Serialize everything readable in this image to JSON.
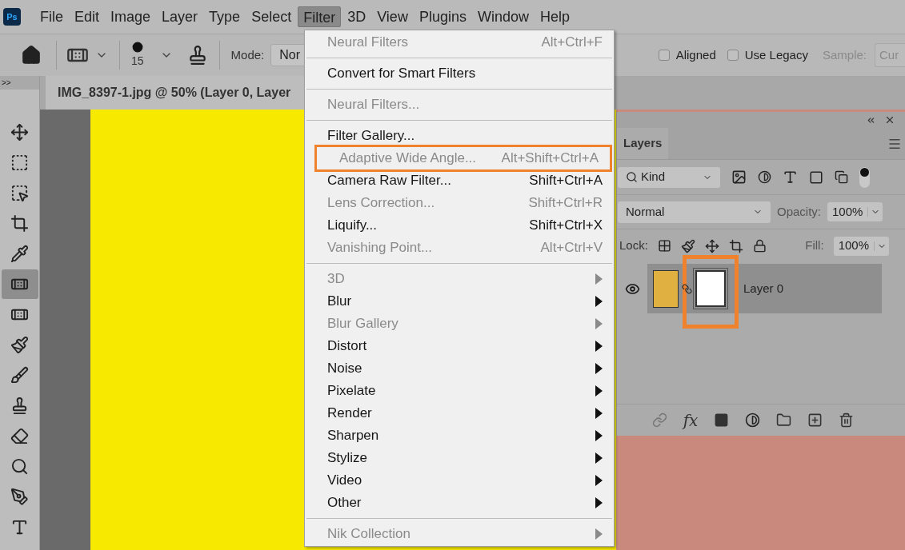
{
  "app_logo": "Ps",
  "menubar": [
    {
      "label": "File",
      "selected": false
    },
    {
      "label": "Edit",
      "selected": false
    },
    {
      "label": "Image",
      "selected": false
    },
    {
      "label": "Layer",
      "selected": false
    },
    {
      "label": "Type",
      "selected": false
    },
    {
      "label": "Select",
      "selected": false
    },
    {
      "label": "Filter",
      "selected": true
    },
    {
      "label": "3D",
      "selected": false
    },
    {
      "label": "View",
      "selected": false
    },
    {
      "label": "Plugins",
      "selected": false
    },
    {
      "label": "Window",
      "selected": false
    },
    {
      "label": "Help",
      "selected": false
    }
  ],
  "options_bar": {
    "brush_size": "15",
    "mode_label": "Mode:",
    "mode_value": "Nor",
    "checkboxes": [
      {
        "label": "Aligned",
        "checked": false
      },
      {
        "label": "Use Legacy",
        "checked": false
      }
    ],
    "sample_label": "Sample:",
    "sample_value": "Cur"
  },
  "toolbar": {
    "collapse": ">>",
    "tools": [
      {
        "kind": "move",
        "selected": false
      },
      {
        "kind": "marquee",
        "selected": false
      },
      {
        "kind": "object-select",
        "selected": false
      },
      {
        "kind": "crop",
        "selected": false
      },
      {
        "kind": "eyedropper",
        "selected": false
      },
      {
        "kind": "healing",
        "selected": true
      },
      {
        "kind": "spot-healing",
        "selected": false
      },
      {
        "kind": "brush",
        "selected": false
      },
      {
        "kind": "mixer-brush",
        "selected": false
      },
      {
        "kind": "stamp",
        "selected": false
      },
      {
        "kind": "eraser",
        "selected": false
      },
      {
        "kind": "burn",
        "selected": false
      },
      {
        "kind": "pen",
        "selected": false
      },
      {
        "kind": "type",
        "selected": false
      }
    ]
  },
  "document_tab": {
    "title": "IMG_8397-1.jpg @ 50% (Layer 0, Layer"
  },
  "filter_menu": [
    {
      "kind": "item",
      "label": "Neural Filters",
      "shortcut": "Alt+Ctrl+F",
      "disabled": true,
      "annotated": false
    },
    {
      "kind": "separator"
    },
    {
      "kind": "item",
      "label": "Convert for Smart Filters",
      "disabled": false,
      "annotated": false
    },
    {
      "kind": "separator"
    },
    {
      "kind": "item",
      "label": "Neural Filters...",
      "disabled": true,
      "annotated": false
    },
    {
      "kind": "separator"
    },
    {
      "kind": "item",
      "label": "Filter Gallery...",
      "disabled": false,
      "annotated": false
    },
    {
      "kind": "item",
      "label": "Adaptive Wide Angle...",
      "shortcut": "Alt+Shift+Ctrl+A",
      "disabled": true,
      "annotated": true
    },
    {
      "kind": "item",
      "label": "Camera Raw Filter...",
      "shortcut": "Shift+Ctrl+A",
      "disabled": false,
      "annotated": false
    },
    {
      "kind": "item",
      "label": "Lens Correction...",
      "shortcut": "Shift+Ctrl+R",
      "disabled": true,
      "annotated": false
    },
    {
      "kind": "item",
      "label": "Liquify...",
      "shortcut": "Shift+Ctrl+X",
      "disabled": false,
      "annotated": false
    },
    {
      "kind": "item",
      "label": "Vanishing Point...",
      "shortcut": "Alt+Ctrl+V",
      "disabled": true,
      "annotated": false
    },
    {
      "kind": "separator"
    },
    {
      "kind": "submenu",
      "label": "3D",
      "disabled": true,
      "annotated": false
    },
    {
      "kind": "submenu",
      "label": "Blur",
      "disabled": false,
      "annotated": false
    },
    {
      "kind": "submenu",
      "label": "Blur Gallery",
      "disabled": true,
      "annotated": false
    },
    {
      "kind": "submenu",
      "label": "Distort",
      "disabled": false,
      "annotated": false
    },
    {
      "kind": "submenu",
      "label": "Noise",
      "disabled": false,
      "annotated": false
    },
    {
      "kind": "submenu",
      "label": "Pixelate",
      "disabled": false,
      "annotated": false
    },
    {
      "kind": "submenu",
      "label": "Render",
      "disabled": false,
      "annotated": false
    },
    {
      "kind": "submenu",
      "label": "Sharpen",
      "disabled": false,
      "annotated": false
    },
    {
      "kind": "submenu",
      "label": "Stylize",
      "disabled": false,
      "annotated": false
    },
    {
      "kind": "submenu",
      "label": "Video",
      "disabled": false,
      "annotated": false
    },
    {
      "kind": "submenu",
      "label": "Other",
      "disabled": false,
      "annotated": false
    },
    {
      "kind": "separator"
    },
    {
      "kind": "submenu",
      "label": "Nik Collection",
      "disabled": true,
      "annotated": false
    }
  ],
  "layers_panel": {
    "tab": "Layers",
    "fx_label": "fx",
    "filter": "Kind",
    "blend_mode": "Normal",
    "opacity_label": "Opacity:",
    "opacity": "100%",
    "lock_label": "Lock:",
    "fill_label": "Fill:",
    "fill": "100%",
    "layers": [
      {
        "name": "Layer 0",
        "visible": true,
        "selected": true,
        "mask_annotated": true
      }
    ]
  }
}
